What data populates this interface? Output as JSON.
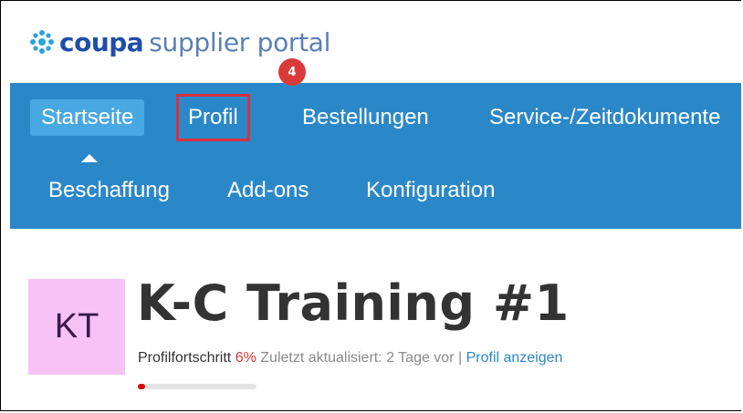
{
  "logo": {
    "brand": "coupa",
    "suffix": "supplier portal"
  },
  "step_badge": "4",
  "nav": {
    "row1": [
      "Startseite",
      "Profil",
      "Bestellungen",
      "Service-/Zeitdokumente"
    ],
    "row2": [
      "Beschaffung",
      "Add-ons",
      "Konfiguration"
    ],
    "active": "Startseite",
    "highlighted": "Profil"
  },
  "profile": {
    "avatar_initials": "KT",
    "name": "K-C Training #1",
    "progress_label": "Profilfortschritt",
    "progress_pct": "6%",
    "progress_value": 0.06,
    "updated_text": "Zuletzt aktualisiert: 2 Tage vor",
    "separator": "|",
    "view_link": "Profil anzeigen"
  },
  "colors": {
    "nav_bg": "#2b88c8",
    "active_tab": "#48a8e2",
    "highlight": "#d93040",
    "avatar_bg": "#f6c3f4"
  }
}
